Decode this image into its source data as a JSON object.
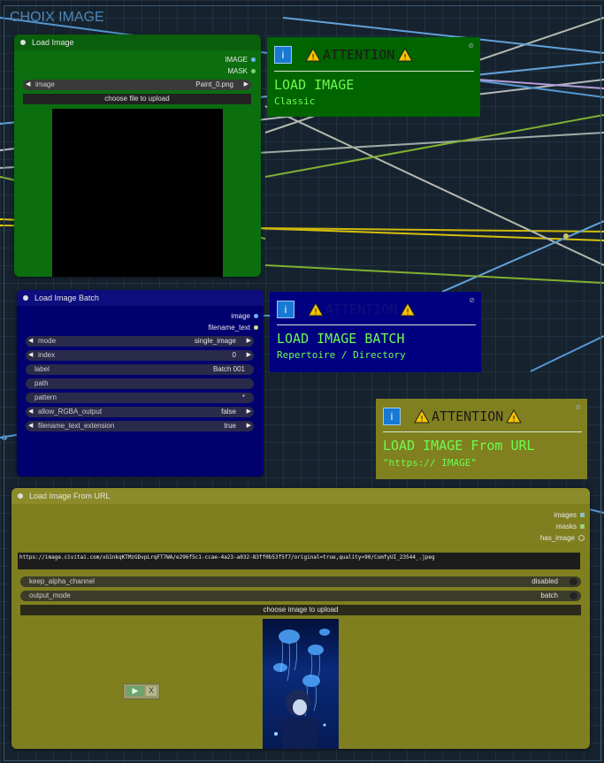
{
  "group": {
    "title": "CHOIX IMAGE"
  },
  "load_image": {
    "title": "Load Image",
    "outputs": [
      "IMAGE",
      "MASK"
    ],
    "image_widget": {
      "label": "image",
      "value": "Paint_0.png"
    },
    "upload_label": "choose file to upload"
  },
  "load_image_batch": {
    "title": "Load Image Batch",
    "outputs": [
      "image",
      "filename_text"
    ],
    "widgets": [
      {
        "label": "mode",
        "value": "single_image",
        "arrows": true
      },
      {
        "label": "index",
        "value": "0",
        "arrows": true
      },
      {
        "label": "label",
        "value": "Batch 001",
        "arrows": false
      },
      {
        "label": "path",
        "value": "",
        "arrows": false
      },
      {
        "label": "pattern",
        "value": "*",
        "arrows": false
      },
      {
        "label": "allow_RGBA_output",
        "value": "false",
        "arrows": true
      },
      {
        "label": "filename_text_extension",
        "value": "true",
        "arrows": true
      }
    ]
  },
  "load_image_url": {
    "title": "Load Image From URL",
    "outputs": [
      "images",
      "masks",
      "has_image"
    ],
    "url": "https://image.civitai.com/xG1nkqKTMzGDvpLrqFT7WA/e296f5c1-ccae-4a23-a032-83ff0b53f5f7/original=true,quality=90/ComfyUI_23544_.jpeg",
    "toggles": [
      {
        "label": "keep_alpha_channel",
        "value": "disabled"
      },
      {
        "label": "output_mode",
        "value": "batch"
      }
    ],
    "upload_label": "choose image to upload"
  },
  "notes": [
    {
      "attention": "ATTENTION",
      "heading": "LOAD IMAGE",
      "sub": "Classic"
    },
    {
      "attention": "ATTENTION",
      "heading": "LOAD IMAGE BATCH",
      "sub": "Repertoire / Directory"
    },
    {
      "attention": "ATTENTION",
      "heading": "LOAD IMAGE From URL",
      "sub": "\"https:// IMAGE\""
    }
  ],
  "colors": {
    "green_node": "#0f6e12",
    "navy_node": "#00006f",
    "olive_node": "#7f7f1f",
    "note_green": "#006400",
    "note_navy": "#000080",
    "note_olive": "#808020"
  }
}
